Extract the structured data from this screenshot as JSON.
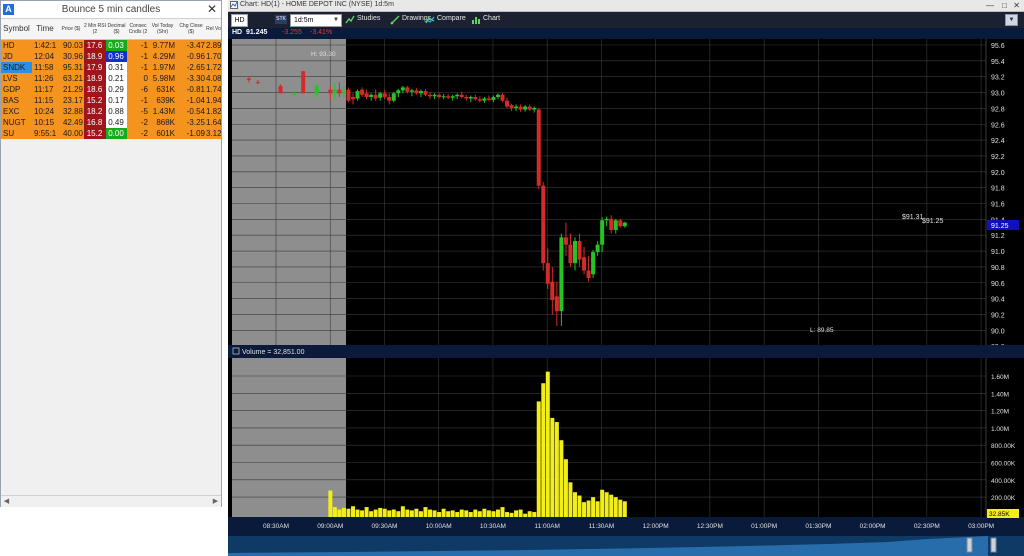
{
  "scanner": {
    "title": "Bounce 5 min candles",
    "app_badge": "A",
    "close_glyph": "✕",
    "columns": [
      {
        "key": "symbol",
        "label": "Symbol"
      },
      {
        "key": "time",
        "label": "Time"
      },
      {
        "key": "price",
        "label": "Price ($)"
      },
      {
        "key": "rsi",
        "label": "2 Min RSI (2"
      },
      {
        "key": "decimal",
        "label": "Decimal ($)"
      },
      {
        "key": "consec",
        "label": "Consec Cndls (2"
      },
      {
        "key": "vol",
        "label": "Vol Today (Shr)"
      },
      {
        "key": "chg",
        "label": "Chg Close ($)"
      },
      {
        "key": "rel",
        "label": "Rel Vo"
      }
    ],
    "rows": [
      {
        "symbol": "HD",
        "time": "1:42:1",
        "price": "90.03",
        "rsi": "17.6",
        "decimal": "0.03",
        "consec": "-1",
        "vol": "9.77M",
        "chg": "-3.47",
        "rel": "2.89",
        "sym_bg": "#f5931f",
        "rsi_bg": "#a0151b",
        "dec_bg": "#19a91c",
        "dec_fg": "#ffffff"
      },
      {
        "symbol": "JD",
        "time": "12:04",
        "price": "30.96",
        "rsi": "18.9",
        "decimal": "0.96",
        "consec": "-1",
        "vol": "4.29M",
        "chg": "-0.96",
        "rel": "1.70",
        "sym_bg": "#f5931f",
        "rsi_bg": "#a0151b",
        "dec_bg": "#1530c8",
        "dec_fg": "#ffffff"
      },
      {
        "symbol": "SNDK",
        "time": "11:58",
        "price": "95.31",
        "rsi": "17.9",
        "decimal": "0.31",
        "consec": "-1",
        "vol": "1.97M",
        "chg": "-2.65",
        "rel": "1.72",
        "sym_bg": "#2b8fe8",
        "rsi_bg": "#a0151b",
        "dec_bg": "#ffffff",
        "dec_fg": "#1a1a1a"
      },
      {
        "symbol": "LVS",
        "time": "11:26",
        "price": "63.21",
        "rsi": "18.9",
        "decimal": "0.21",
        "consec": "0",
        "vol": "5.98M",
        "chg": "-3.30",
        "rel": "4.08",
        "sym_bg": "#f5931f",
        "rsi_bg": "#a0151b",
        "dec_bg": "#ffffff",
        "dec_fg": "#1a1a1a"
      },
      {
        "symbol": "GDP",
        "time": "11:17",
        "price": "21.29",
        "rsi": "18.6",
        "decimal": "0.29",
        "consec": "-6",
        "vol": "631K",
        "chg": "-0.81",
        "rel": "1.74",
        "sym_bg": "#f5931f",
        "rsi_bg": "#a0151b",
        "dec_bg": "#ffffff",
        "dec_fg": "#1a1a1a"
      },
      {
        "symbol": "BAS",
        "time": "11:15",
        "price": "23.17",
        "rsi": "15.2",
        "decimal": "0.17",
        "consec": "-1",
        "vol": "639K",
        "chg": "-1.04",
        "rel": "1.94",
        "sym_bg": "#f5931f",
        "rsi_bg": "#a0151b",
        "dec_bg": "#ffffff",
        "dec_fg": "#1a1a1a"
      },
      {
        "symbol": "EXC",
        "time": "10:24",
        "price": "32.88",
        "rsi": "18.2",
        "decimal": "0.88",
        "consec": "-5",
        "vol": "1.43M",
        "chg": "-0.54",
        "rel": "1.82",
        "sym_bg": "#f5931f",
        "rsi_bg": "#a0151b",
        "dec_bg": "#ffffff",
        "dec_fg": "#1a1a1a"
      },
      {
        "symbol": "NUGT",
        "time": "10:15",
        "price": "42.49",
        "rsi": "16.8",
        "decimal": "0.49",
        "consec": "-2",
        "vol": "868K",
        "chg": "-3.25",
        "rel": "1.64",
        "sym_bg": "#f5931f",
        "rsi_bg": "#a0151b",
        "dec_bg": "#ffffff",
        "dec_fg": "#1a1a1a"
      },
      {
        "symbol": "SU",
        "time": "9:55:1",
        "price": "40.00",
        "rsi": "15.2",
        "decimal": "0.00",
        "consec": "-2",
        "vol": "601K",
        "chg": "-1.09",
        "rel": "3.12",
        "sym_bg": "#f5931f",
        "rsi_bg": "#a0151b",
        "dec_bg": "#19a91c",
        "dec_fg": "#ffffff"
      }
    ]
  },
  "chart_window": {
    "title": "Chart: HD(1) - HOME DEPOT INC (NYSE) 1d:5m",
    "toolbar": {
      "symbol": "HD",
      "stk_label": "STK",
      "interval": "1d:5m",
      "studies": "Studies",
      "drawings": "Drawings",
      "compare": "Compare",
      "chart": "Chart"
    },
    "price_header": {
      "symbol": "HD",
      "last": "91.245",
      "change": "-3.255",
      "pct": "-3.41%"
    },
    "volume_header": "Volume = 32,851.00",
    "high_label": "H: 93.30",
    "low_label": "L: 89.85",
    "ann_1": "$91.31",
    "ann_2": "$91.25",
    "last_price_tag": "91.25",
    "last_volume_tag": "32.85K"
  },
  "chart_data": [
    {
      "type": "candlestick",
      "title": "HD 91.245",
      "y_ticks": [
        "95.6",
        "95.4",
        "93.2",
        "93.0",
        "92.8",
        "92.6",
        "92.4",
        "92.2",
        "92.0",
        "91.8",
        "91.6",
        "91.4",
        "91.2",
        "91.0",
        "90.8",
        "90.6",
        "90.4",
        "90.2",
        "90.0",
        "89.8"
      ],
      "ylim": [
        89.7,
        93.6
      ],
      "x_ticks": [
        "08:30AM",
        "09:00AM",
        "09:30AM",
        "10:00AM",
        "10:30AM",
        "11:00AM",
        "11:30AM",
        "12:00PM",
        "12:30PM",
        "01:00PM",
        "01:30PM",
        "02:00PM",
        "02:30PM",
        "03:00PM"
      ],
      "premarket_end": "09:30AM",
      "candles": [
        {
          "t": "08:00",
          "o": 93.2,
          "h": 93.23,
          "l": 93.15,
          "c": 93.18
        },
        {
          "t": "08:10",
          "o": 93.15,
          "h": 93.18,
          "l": 93.12,
          "c": 93.14
        },
        {
          "t": "08:35",
          "o": 93.1,
          "h": 93.12,
          "l": 93.0,
          "c": 93.0
        },
        {
          "t": "08:50",
          "o": 93.0,
          "h": 93.03,
          "l": 92.97,
          "c": 93.0
        },
        {
          "t": "09:00",
          "o": 93.3,
          "h": 93.3,
          "l": 93.0,
          "c": 93.0
        },
        {
          "t": "09:15",
          "o": 93.0,
          "h": 93.12,
          "l": 92.95,
          "c": 93.1
        },
        {
          "t": "09:30",
          "o": 93.05,
          "h": 93.1,
          "l": 92.9,
          "c": 93.0
        },
        {
          "t": "09:35",
          "o": 93.0,
          "h": 93.15,
          "l": 92.92,
          "c": 93.05
        },
        {
          "t": "09:40",
          "o": 93.05,
          "h": 93.15,
          "l": 92.95,
          "c": 93.0
        },
        {
          "t": "09:45",
          "o": 93.0,
          "h": 93.1,
          "l": 92.95,
          "c": 93.02
        },
        {
          "t": "09:50",
          "o": 93.05,
          "h": 93.08,
          "l": 92.88,
          "c": 92.9
        },
        {
          "t": "09:55",
          "o": 92.95,
          "h": 93.0,
          "l": 92.85,
          "c": 92.92
        },
        {
          "t": "10:00",
          "o": 92.93,
          "h": 93.05,
          "l": 92.9,
          "c": 93.03
        },
        {
          "t": "10:05",
          "o": 93.05,
          "h": 93.08,
          "l": 92.95,
          "c": 92.98
        },
        {
          "t": "10:10",
          "o": 93.0,
          "h": 93.05,
          "l": 92.92,
          "c": 92.95
        },
        {
          "t": "10:15",
          "o": 92.95,
          "h": 93.0,
          "l": 92.9,
          "c": 92.98
        },
        {
          "t": "10:20",
          "o": 92.98,
          "h": 93.05,
          "l": 92.9,
          "c": 92.93
        },
        {
          "t": "10:25",
          "o": 92.94,
          "h": 93.02,
          "l": 92.9,
          "c": 93.0
        },
        {
          "t": "10:30",
          "o": 93.0,
          "h": 93.05,
          "l": 92.92,
          "c": 92.95
        },
        {
          "t": "10:35",
          "o": 92.95,
          "h": 93.0,
          "l": 92.85,
          "c": 92.9
        },
        {
          "t": "10:40",
          "o": 92.9,
          "h": 93.02,
          "l": 92.88,
          "c": 93.0
        },
        {
          "t": "10:45",
          "o": 93.0,
          "h": 93.06,
          "l": 92.95,
          "c": 93.04
        },
        {
          "t": "10:50",
          "o": 93.04,
          "h": 93.1,
          "l": 93.0,
          "c": 93.08
        },
        {
          "t": "10:55",
          "o": 93.08,
          "h": 93.1,
          "l": 93.0,
          "c": 93.02
        },
        {
          "t": "11:00",
          "o": 93.02,
          "h": 93.06,
          "l": 92.96,
          "c": 93.04
        },
        {
          "t": "11:05",
          "o": 93.04,
          "h": 93.07,
          "l": 92.98,
          "c": 93.0
        },
        {
          "t": "11:10",
          "o": 93.0,
          "h": 93.05,
          "l": 92.95,
          "c": 93.03
        },
        {
          "t": "11:15",
          "o": 93.03,
          "h": 93.06,
          "l": 92.96,
          "c": 92.98
        },
        {
          "t": "11:20",
          "o": 92.98,
          "h": 93.02,
          "l": 92.92,
          "c": 92.96
        },
        {
          "t": "11:25",
          "o": 92.96,
          "h": 93.0,
          "l": 92.92,
          "c": 92.98
        },
        {
          "t": "11:30",
          "o": 92.98,
          "h": 93.0,
          "l": 92.93,
          "c": 92.95
        },
        {
          "t": "11:35",
          "o": 92.95,
          "h": 92.99,
          "l": 92.92,
          "c": 92.96
        },
        {
          "t": "11:40",
          "o": 92.96,
          "h": 92.99,
          "l": 92.92,
          "c": 92.94
        },
        {
          "t": "11:45",
          "o": 92.94,
          "h": 92.98,
          "l": 92.9,
          "c": 92.96
        },
        {
          "t": "11:50",
          "o": 92.96,
          "h": 93.0,
          "l": 92.92,
          "c": 92.98
        },
        {
          "t": "11:55",
          "o": 92.98,
          "h": 93.02,
          "l": 92.93,
          "c": 92.95
        },
        {
          "t": "12:00",
          "o": 92.95,
          "h": 92.98,
          "l": 92.9,
          "c": 92.93
        },
        {
          "t": "12:05",
          "o": 92.93,
          "h": 92.97,
          "l": 92.88,
          "c": 92.95
        },
        {
          "t": "12:10",
          "o": 92.95,
          "h": 92.98,
          "l": 92.9,
          "c": 92.92
        },
        {
          "t": "12:15",
          "o": 92.92,
          "h": 92.96,
          "l": 92.88,
          "c": 92.9
        },
        {
          "t": "12:20",
          "o": 92.9,
          "h": 92.95,
          "l": 92.87,
          "c": 92.93
        },
        {
          "t": "12:25",
          "o": 92.93,
          "h": 92.97,
          "l": 92.89,
          "c": 92.91
        },
        {
          "t": "12:30",
          "o": 92.91,
          "h": 92.97,
          "l": 92.88,
          "c": 92.95
        },
        {
          "t": "12:35",
          "o": 92.95,
          "h": 93.0,
          "l": 92.92,
          "c": 92.98
        },
        {
          "t": "12:40",
          "o": 92.98,
          "h": 93.0,
          "l": 92.88,
          "c": 92.9
        },
        {
          "t": "12:45",
          "o": 92.9,
          "h": 92.94,
          "l": 92.8,
          "c": 92.82
        },
        {
          "t": "12:50",
          "o": 92.84,
          "h": 92.86,
          "l": 92.76,
          "c": 92.8
        },
        {
          "t": "12:55",
          "o": 92.8,
          "h": 92.85,
          "l": 92.76,
          "c": 92.82
        },
        {
          "t": "13:00",
          "o": 92.82,
          "h": 92.85,
          "l": 92.75,
          "c": 92.78
        },
        {
          "t": "13:05",
          "o": 92.78,
          "h": 92.84,
          "l": 92.75,
          "c": 92.82
        },
        {
          "t": "13:10",
          "o": 92.82,
          "h": 92.85,
          "l": 92.76,
          "c": 92.78
        },
        {
          "t": "13:15",
          "o": 92.78,
          "h": 92.82,
          "l": 92.74,
          "c": 92.8
        },
        {
          "t": "13:20",
          "o": 92.78,
          "h": 92.8,
          "l": 91.7,
          "c": 91.75
        },
        {
          "t": "13:25",
          "o": 91.75,
          "h": 91.8,
          "l": 90.6,
          "c": 90.7
        },
        {
          "t": "13:30",
          "o": 90.7,
          "h": 90.9,
          "l": 90.35,
          "c": 90.42
        },
        {
          "t": "13:35",
          "o": 90.45,
          "h": 90.65,
          "l": 90.0,
          "c": 90.2
        },
        {
          "t": "13:40",
          "o": 90.25,
          "h": 90.45,
          "l": 89.85,
          "c": 90.05
        },
        {
          "t": "13:45",
          "o": 90.05,
          "h": 91.1,
          "l": 89.85,
          "c": 91.05
        },
        {
          "t": "13:50",
          "o": 91.05,
          "h": 91.25,
          "l": 90.8,
          "c": 90.95
        },
        {
          "t": "13:55",
          "o": 90.95,
          "h": 91.1,
          "l": 90.65,
          "c": 90.7
        },
        {
          "t": "14:00",
          "o": 90.7,
          "h": 91.05,
          "l": 90.6,
          "c": 91.0
        },
        {
          "t": "14:05",
          "o": 91.0,
          "h": 91.1,
          "l": 90.65,
          "c": 90.75
        },
        {
          "t": "14:10",
          "o": 90.78,
          "h": 90.92,
          "l": 90.55,
          "c": 90.6
        },
        {
          "t": "14:15",
          "o": 90.6,
          "h": 90.8,
          "l": 90.45,
          "c": 90.5
        },
        {
          "t": "14:20",
          "o": 90.55,
          "h": 90.88,
          "l": 90.5,
          "c": 90.85
        },
        {
          "t": "14:25",
          "o": 90.85,
          "h": 91.0,
          "l": 90.8,
          "c": 90.95
        },
        {
          "t": "14:30",
          "o": 90.95,
          "h": 91.32,
          "l": 90.85,
          "c": 91.28
        },
        {
          "t": "14:35",
          "o": 91.28,
          "h": 91.33,
          "l": 91.2,
          "c": 91.3
        },
        {
          "t": "14:40",
          "o": 91.3,
          "h": 91.35,
          "l": 91.1,
          "c": 91.15
        },
        {
          "t": "14:45",
          "o": 91.15,
          "h": 91.3,
          "l": 91.1,
          "c": 91.28
        },
        {
          "t": "14:50",
          "o": 91.28,
          "h": 91.3,
          "l": 91.18,
          "c": 91.2
        },
        {
          "t": "14:55",
          "o": 91.2,
          "h": 91.26,
          "l": 91.18,
          "c": 91.25
        }
      ]
    },
    {
      "type": "bar",
      "title": "Volume",
      "y_ticks": [
        "1.60M",
        "1.40M",
        "1.20M",
        "1.00M",
        "800.00K",
        "600.00K",
        "400.00K",
        "200.00K"
      ],
      "ylim": [
        0,
        1780000
      ],
      "categories": [
        "09:30",
        "09:35",
        "09:40",
        "09:45",
        "09:50",
        "09:55",
        "10:00",
        "10:05",
        "10:10",
        "10:15",
        "10:20",
        "10:25",
        "10:30",
        "10:35",
        "10:40",
        "10:45",
        "10:50",
        "10:55",
        "11:00",
        "11:05",
        "11:10",
        "11:15",
        "11:20",
        "11:25",
        "11:30",
        "11:35",
        "11:40",
        "11:45",
        "11:50",
        "11:55",
        "12:00",
        "12:05",
        "12:10",
        "12:15",
        "12:20",
        "12:25",
        "12:30",
        "12:35",
        "12:40",
        "12:45",
        "12:50",
        "12:55",
        "13:00",
        "13:05",
        "13:10",
        "13:15",
        "13:20",
        "13:25",
        "13:30",
        "13:35",
        "13:40",
        "13:45",
        "13:50",
        "13:55",
        "14:00",
        "14:05",
        "14:10",
        "14:15",
        "14:20",
        "14:25",
        "14:30",
        "14:35",
        "14:40",
        "14:45",
        "14:50",
        "14:55"
      ],
      "values": [
        320000,
        120000,
        90000,
        110000,
        100000,
        130000,
        90000,
        80000,
        120000,
        70000,
        90000,
        110000,
        100000,
        80000,
        90000,
        70000,
        130000,
        90000,
        80000,
        100000,
        70000,
        120000,
        90000,
        80000,
        60000,
        100000,
        70000,
        80000,
        60000,
        90000,
        80000,
        60000,
        90000,
        70000,
        100000,
        80000,
        70000,
        90000,
        120000,
        60000,
        50000,
        80000,
        90000,
        40000,
        70000,
        60000,
        1400000,
        1620000,
        1760000,
        1200000,
        1150000,
        930000,
        700000,
        420000,
        300000,
        260000,
        180000,
        200000,
        240000,
        190000,
        330000,
        300000,
        270000,
        240000,
        210000,
        190000
      ]
    }
  ]
}
